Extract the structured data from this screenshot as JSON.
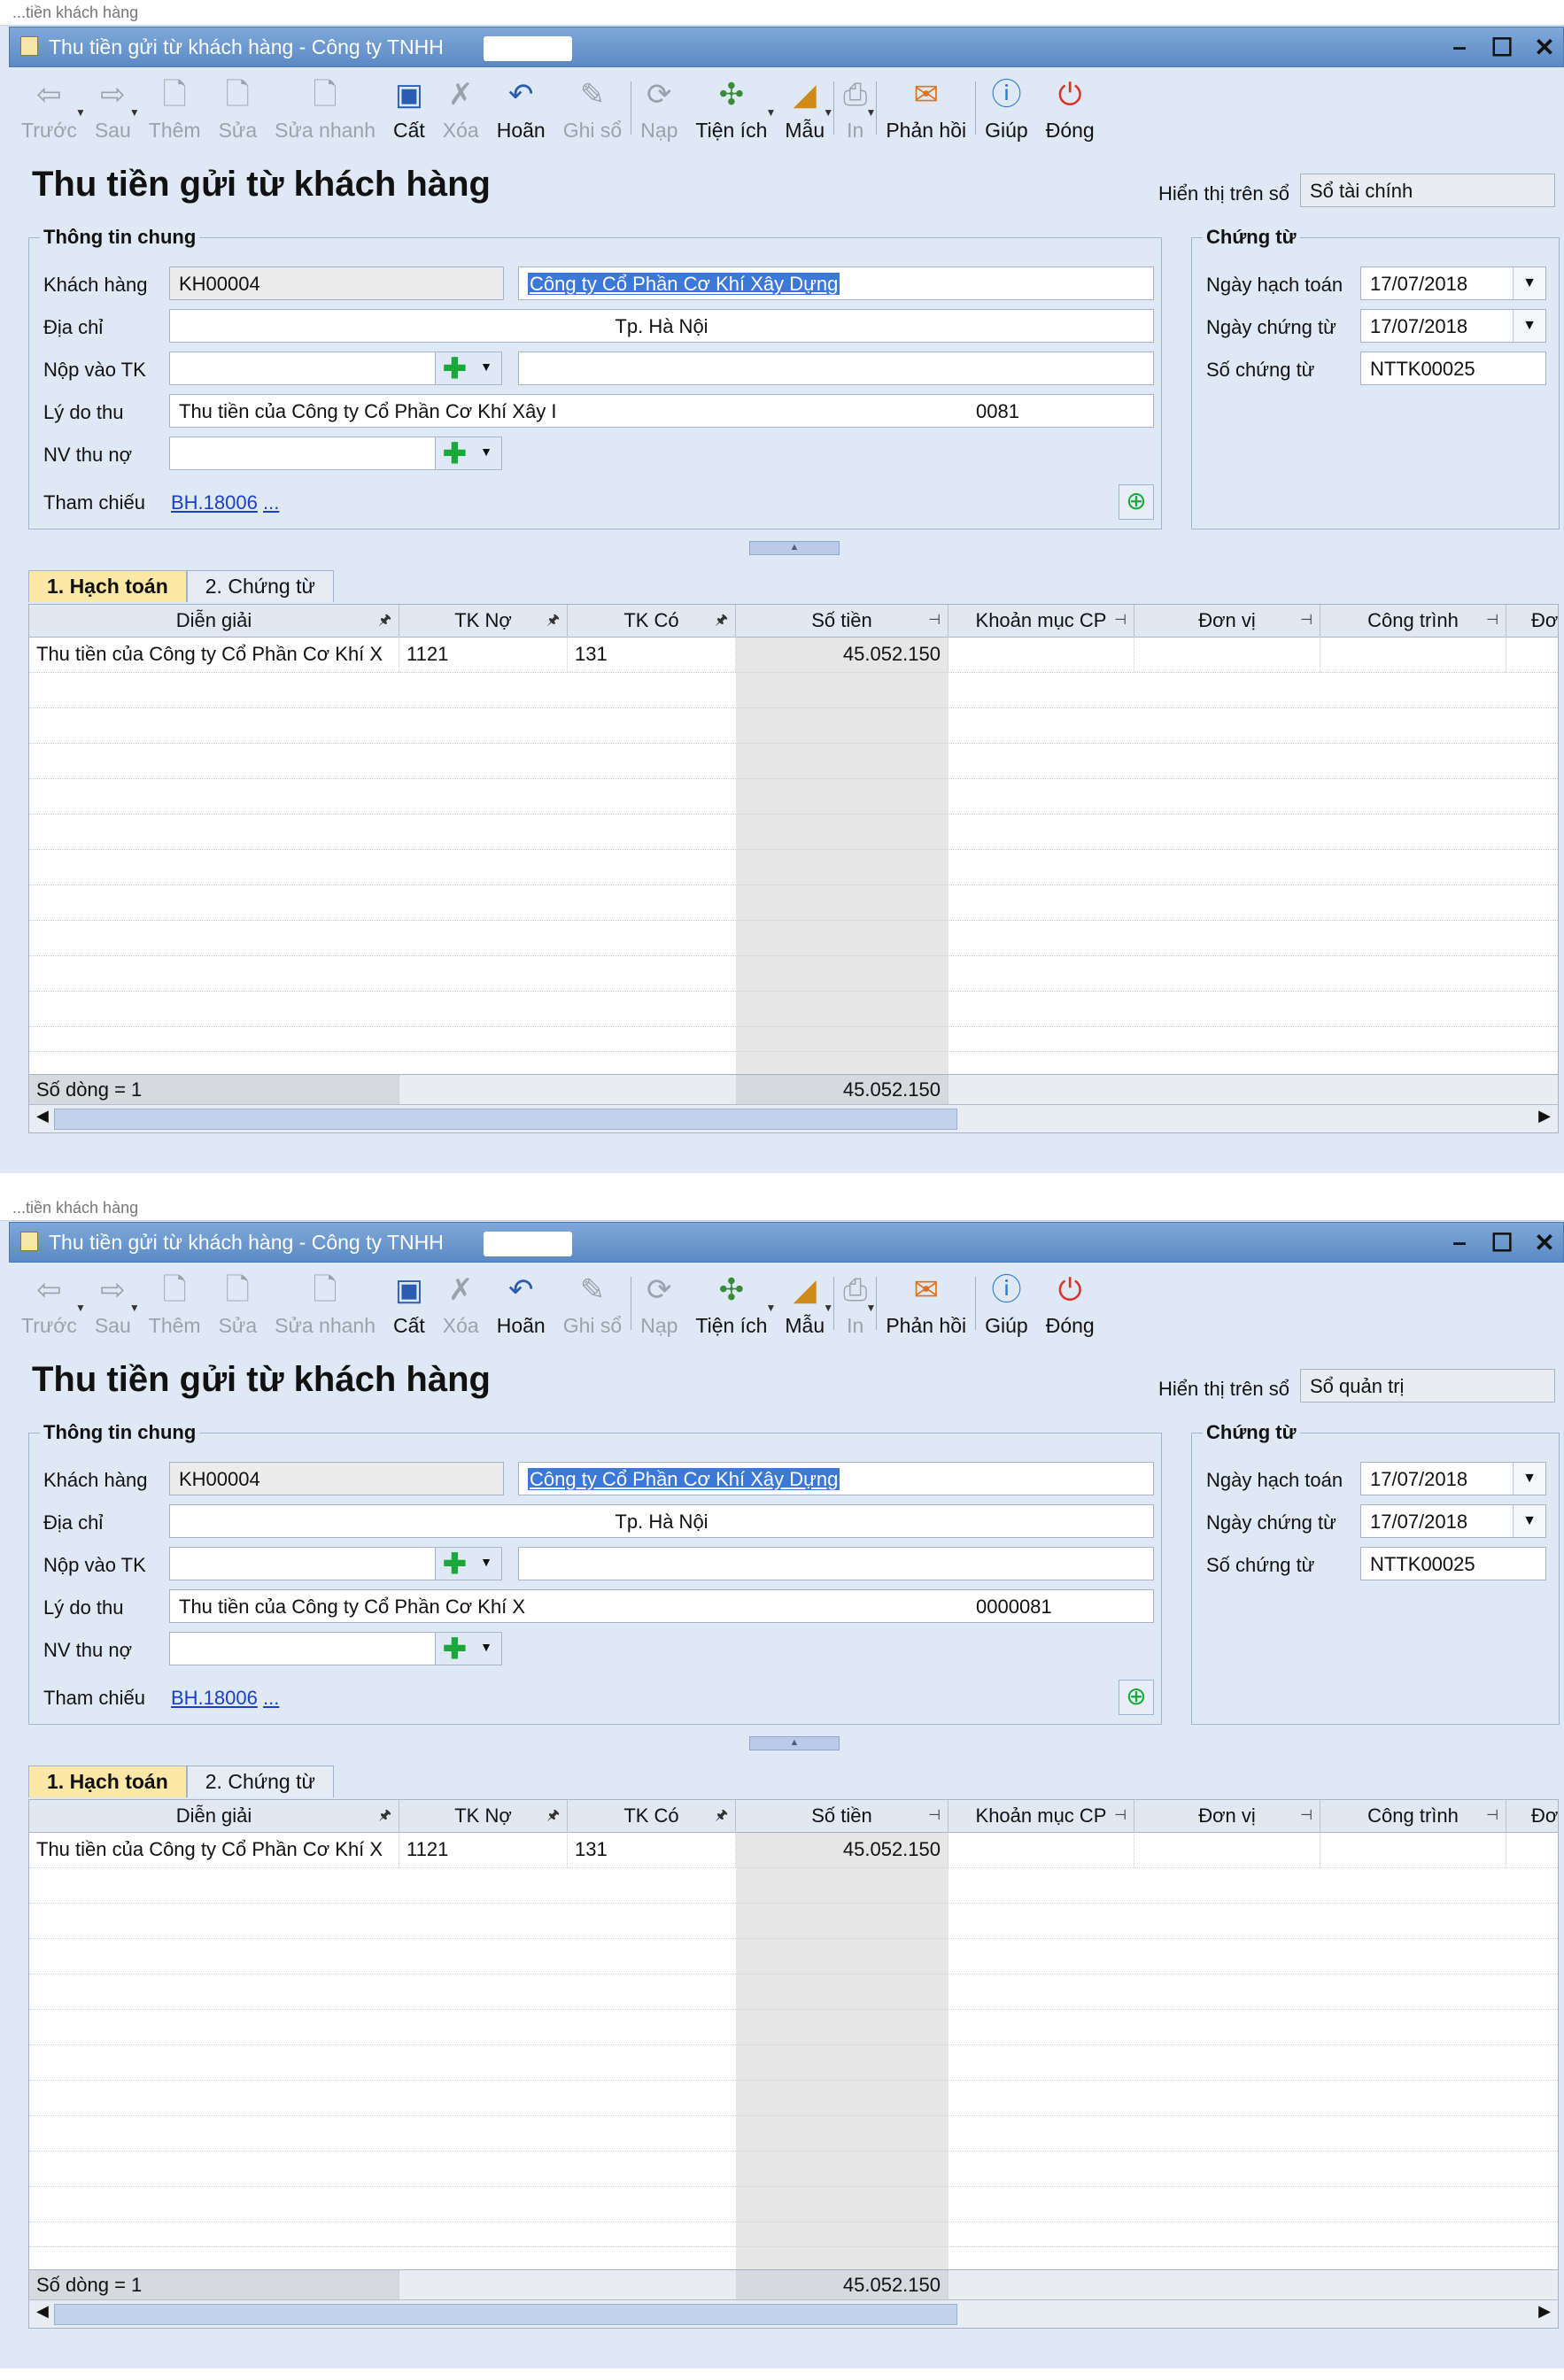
{
  "windows": [
    {
      "strip_label": "...tiền khách hàng",
      "title": "Thu tiền gửi từ khách hàng - Công ty TNHH",
      "window_controls": [
        "–",
        "☐",
        "✕"
      ],
      "toolbar": [
        {
          "label": "Trước",
          "icon": "back-arrow-icon",
          "enabled": false,
          "dropdown": true
        },
        {
          "label": "Sau",
          "icon": "forward-arrow-icon",
          "enabled": false,
          "dropdown": true
        },
        {
          "label": "Thêm",
          "icon": "add-document-icon",
          "enabled": false
        },
        {
          "label": "Sửa",
          "icon": "edit-document-icon",
          "enabled": false
        },
        {
          "label": "Sửa nhanh",
          "icon": "quick-edit-icon",
          "enabled": false
        },
        {
          "label": "Cất",
          "icon": "save-icon",
          "enabled": true
        },
        {
          "label": "Xóa",
          "icon": "delete-icon",
          "enabled": false
        },
        {
          "label": "Hoãn",
          "icon": "undo-icon",
          "enabled": true
        },
        {
          "label": "Ghi sổ",
          "icon": "pencil-icon",
          "enabled": false
        },
        {
          "label": "Nạp",
          "icon": "reload-icon",
          "enabled": false
        },
        {
          "label": "Tiện ích",
          "icon": "tools-icon",
          "enabled": true,
          "dropdown": true
        },
        {
          "label": "Mẫu",
          "icon": "template-icon",
          "enabled": true,
          "dropdown": true
        },
        {
          "label": "In",
          "icon": "print-icon",
          "enabled": false,
          "dropdown": true
        },
        {
          "label": "Phản hồi",
          "icon": "mail-icon",
          "enabled": true
        },
        {
          "label": "Giúp",
          "icon": "help-icon",
          "enabled": true
        },
        {
          "label": "Đóng",
          "icon": "close-power-icon",
          "enabled": true
        }
      ],
      "heading": "Thu tiền gửi từ khách hàng",
      "display_label": "Hiển thị trên sổ",
      "display_value": "Sổ tài chính",
      "general": {
        "title": "Thông tin chung",
        "customer_label": "Khách hàng",
        "customer_code": "KH00004",
        "customer_name": "Công ty Cổ Phần Cơ Khí Xây Dựng",
        "address_label": "Địa chỉ",
        "address": "Tp. Hà Nội",
        "account_label": "Nộp vào TK",
        "reason_label": "Lý do thu",
        "reason": "Thu tiền của Công ty Cổ Phần Cơ Khí Xây I",
        "reason_tail": "0081",
        "staff_label": "NV thu nợ",
        "ref_label": "Tham chiếu",
        "ref_link": "BH.18006",
        "ref_more": "..."
      },
      "voucher": {
        "title": "Chứng từ",
        "posting_date_label": "Ngày hạch toán",
        "posting_date": "17/07/2018",
        "voucher_date_label": "Ngày chứng từ",
        "voucher_date": "17/07/2018",
        "voucher_no_label": "Số chứng từ",
        "voucher_no": "NTTK00025"
      },
      "tabs": [
        "1. Hạch toán",
        "2. Chứng từ"
      ],
      "columns": [
        "Diễn giải",
        "TK Nợ",
        "TK Có",
        "Số tiền",
        "Khoản mục CP",
        "Đơn vị",
        "Công trình",
        "Đơ"
      ],
      "rows": [
        {
          "desc": "Thu tiền của Công ty Cổ Phần Cơ Khí X",
          "debit": "1121",
          "credit": "131",
          "amount": "45.052.150"
        }
      ],
      "footer": {
        "row_count": "Số dòng = 1",
        "total": "45.052.150"
      }
    },
    {
      "strip_label": "...tiền khách hàng",
      "title": "Thu tiền gửi từ khách hàng - Công ty TNHH",
      "window_controls": [
        "–",
        "☐",
        "✕"
      ],
      "toolbar": [
        {
          "label": "Trước",
          "icon": "back-arrow-icon",
          "enabled": false,
          "dropdown": true
        },
        {
          "label": "Sau",
          "icon": "forward-arrow-icon",
          "enabled": false,
          "dropdown": true
        },
        {
          "label": "Thêm",
          "icon": "add-document-icon",
          "enabled": false
        },
        {
          "label": "Sửa",
          "icon": "edit-document-icon",
          "enabled": false
        },
        {
          "label": "Sửa nhanh",
          "icon": "quick-edit-icon",
          "enabled": false
        },
        {
          "label": "Cất",
          "icon": "save-icon",
          "enabled": true
        },
        {
          "label": "Xóa",
          "icon": "delete-icon",
          "enabled": false
        },
        {
          "label": "Hoãn",
          "icon": "undo-icon",
          "enabled": true
        },
        {
          "label": "Ghi sổ",
          "icon": "pencil-icon",
          "enabled": false
        },
        {
          "label": "Nạp",
          "icon": "reload-icon",
          "enabled": false
        },
        {
          "label": "Tiện ích",
          "icon": "tools-icon",
          "enabled": true,
          "dropdown": true
        },
        {
          "label": "Mẫu",
          "icon": "template-icon",
          "enabled": true,
          "dropdown": true
        },
        {
          "label": "In",
          "icon": "print-icon",
          "enabled": false,
          "dropdown": true
        },
        {
          "label": "Phản hồi",
          "icon": "mail-icon",
          "enabled": true
        },
        {
          "label": "Giúp",
          "icon": "help-icon",
          "enabled": true
        },
        {
          "label": "Đóng",
          "icon": "close-power-icon",
          "enabled": true
        }
      ],
      "heading": "Thu tiền gửi từ khách hàng",
      "display_label": "Hiển thị trên sổ",
      "display_value": "Sổ quản trị",
      "general": {
        "title": "Thông tin chung",
        "customer_label": "Khách hàng",
        "customer_code": "KH00004",
        "customer_name": "Công ty Cổ Phần Cơ Khí Xây Dựng",
        "address_label": "Địa chỉ",
        "address": "Tp. Hà Nội",
        "account_label": "Nộp vào TK",
        "reason_label": "Lý do thu",
        "reason": "Thu tiền của Công ty Cổ Phần Cơ Khí X",
        "reason_tail": "0000081",
        "staff_label": "NV thu nợ",
        "ref_label": "Tham chiếu",
        "ref_link": "BH.18006",
        "ref_more": "..."
      },
      "voucher": {
        "title": "Chứng từ",
        "posting_date_label": "Ngày hạch toán",
        "posting_date": "17/07/2018",
        "voucher_date_label": "Ngày chứng từ",
        "voucher_date": "17/07/2018",
        "voucher_no_label": "Số chứng từ",
        "voucher_no": "NTTK00025"
      },
      "tabs": [
        "1. Hạch toán",
        "2. Chứng từ"
      ],
      "columns": [
        "Diễn giải",
        "TK Nợ",
        "TK Có",
        "Số tiền",
        "Khoản mục CP",
        "Đơn vị",
        "Công trình",
        "Đơ"
      ],
      "rows": [
        {
          "desc": "Thu tiền của Công ty Cổ Phần Cơ Khí X",
          "debit": "1121",
          "credit": "131",
          "amount": "45.052.150"
        }
      ],
      "footer": {
        "row_count": "Số dòng = 1",
        "total": "45.052.150"
      }
    }
  ]
}
